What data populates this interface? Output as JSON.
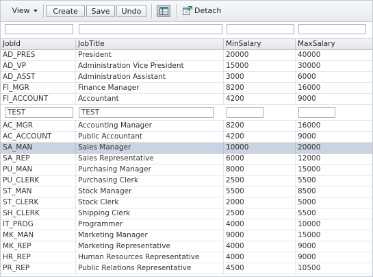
{
  "toolbar": {
    "view_label": "View",
    "create_label": "Create",
    "save_label": "Save",
    "undo_label": "Undo",
    "detach_label": "Detach"
  },
  "table": {
    "columns": [
      "JobId",
      "JobTitle",
      "MinSalary",
      "MaxSalary"
    ],
    "rows_before": [
      [
        "AD_PRES",
        "President",
        "20000",
        "40000"
      ],
      [
        "AD_VP",
        "Administration Vice President",
        "15000",
        "30000"
      ],
      [
        "AD_ASST",
        "Administration Assistant",
        "3000",
        "6000"
      ],
      [
        "FI_MGR",
        "Finance Manager",
        "8200",
        "16000"
      ],
      [
        "FI_ACCOUNT",
        "Accountant",
        "4200",
        "9000"
      ]
    ],
    "insert_row": {
      "job_id": "TEST",
      "job_title": "TEST",
      "min_salary": "",
      "max_salary": ""
    },
    "rows_after": [
      [
        "AC_MGR",
        "Accounting Manager",
        "8200",
        "16000"
      ],
      [
        "AC_ACCOUNT",
        "Public Accountant",
        "4200",
        "9000"
      ],
      [
        "SA_MAN",
        "Sales Manager",
        "10000",
        "20000"
      ],
      [
        "SA_REP",
        "Sales Representative",
        "6000",
        "12000"
      ],
      [
        "PU_MAN",
        "Purchasing Manager",
        "8000",
        "15000"
      ],
      [
        "PU_CLERK",
        "Purchasing Clerk",
        "2500",
        "5500"
      ],
      [
        "ST_MAN",
        "Stock Manager",
        "5500",
        "8500"
      ],
      [
        "ST_CLERK",
        "Stock Clerk",
        "2000",
        "5000"
      ],
      [
        "SH_CLERK",
        "Shipping Clerk",
        "2500",
        "5500"
      ],
      [
        "IT_PROG",
        "Programmer",
        "4000",
        "10000"
      ],
      [
        "MK_MAN",
        "Marketing Manager",
        "9000",
        "15000"
      ],
      [
        "MK_REP",
        "Marketing Representative",
        "4000",
        "9000"
      ],
      [
        "HR_REP",
        "Human Resources Representative",
        "4000",
        "9000"
      ],
      [
        "PR_REP",
        "Public Relations Representative",
        "4500",
        "10500"
      ]
    ],
    "selected_job_id": "SA_MAN"
  },
  "icons": {
    "freeze": "freeze-columns-icon",
    "detach": "detach-icon",
    "view_caret": "chevron-down-icon"
  },
  "colors": {
    "selected_row": "#c9d3e2",
    "toolbar_bg": "#e8ebee",
    "header_bg": "#e3e6ea"
  }
}
